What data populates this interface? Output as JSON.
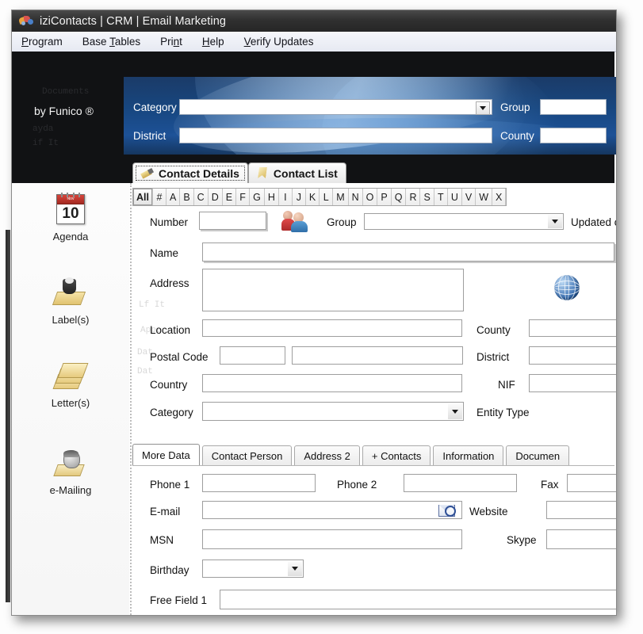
{
  "window": {
    "title": "iziContacts | CRM | Email Marketing",
    "title_icon": "butterfly-logo-icon",
    "brand": "by Funico ®"
  },
  "menu": {
    "items": [
      {
        "label": "Program",
        "accel": "P"
      },
      {
        "label": "Base Tables",
        "accel": "T"
      },
      {
        "label": "Print",
        "accel": "n"
      },
      {
        "label": "Help",
        "accel": "H"
      },
      {
        "label": "Verify Updates",
        "accel": "V"
      }
    ]
  },
  "banner": {
    "category_label": "Category",
    "category_value": "",
    "district_label": "District",
    "district_value": "",
    "group_label": "Group",
    "group_value": "",
    "county_label": "County",
    "county_value": ""
  },
  "main_tabs": [
    {
      "label": "Contact Details",
      "icon": "pencil-icon",
      "active": true
    },
    {
      "label": "Contact List",
      "icon": "bookmark-icon",
      "active": false
    }
  ],
  "alpha_filter": {
    "selected": "All",
    "items": [
      "All",
      "#",
      "A",
      "B",
      "C",
      "D",
      "E",
      "F",
      "G",
      "H",
      "I",
      "J",
      "K",
      "L",
      "M",
      "N",
      "O",
      "P",
      "Q",
      "R",
      "S",
      "T",
      "U",
      "V",
      "W",
      "X"
    ]
  },
  "sidebar": {
    "items": [
      {
        "label": "Agenda",
        "icon": "calendar-icon",
        "day": "10",
        "month": "Nov"
      },
      {
        "label": "Label(s)",
        "icon": "label-printer-icon"
      },
      {
        "label": "Letter(s)",
        "icon": "letters-icon"
      },
      {
        "label": "e-Mailing",
        "icon": "email-person-icon"
      }
    ]
  },
  "form": {
    "number_label": "Number",
    "number_value": "",
    "people_icon": "two-people-icon",
    "group_label": "Group",
    "group_value": "",
    "updated_label": "Updated o",
    "name_label": "Name",
    "name_value": "",
    "address_label": "Address",
    "address_value": "",
    "globe_icon": "globe-icon",
    "location_label": "Location",
    "location_value": "",
    "county_label": "County",
    "county_value": "",
    "postal_code_label": "Postal Code",
    "postal_code_value": "",
    "postal_city_value": "",
    "district_label": "District",
    "district_value": "",
    "country_label": "Country",
    "country_value": "",
    "nif_label": "NIF",
    "nif_value": "",
    "category_label": "Category",
    "category_value": "",
    "entity_type_label": "Entity Type"
  },
  "sub_tabs": [
    {
      "label": "More Data",
      "active": true
    },
    {
      "label": "Contact Person",
      "active": false
    },
    {
      "label": "Address 2",
      "active": false
    },
    {
      "label": "+ Contacts",
      "active": false
    },
    {
      "label": "Information",
      "active": false
    },
    {
      "label": "Documen",
      "active": false
    }
  ],
  "more_data": {
    "phone1_label": "Phone 1",
    "phone1_value": "",
    "phone2_label": "Phone 2",
    "phone2_value": "",
    "fax_label": "Fax",
    "fax_value": "",
    "email_label": "E-mail",
    "email_value": "",
    "email_icon": "email-search-icon",
    "website_label": "Website",
    "website_value": "",
    "msn_label": "MSN",
    "msn_value": "",
    "skype_label": "Skype",
    "skype_value": "",
    "birthday_label": "Birthday",
    "birthday_value": "",
    "free_field1_label": "Free Field 1",
    "free_field1_value": ""
  },
  "colors": {
    "banner_blue": "#1d5196",
    "banner_dark": "#15365f",
    "titlebar": "#303030",
    "app_background": "#111214",
    "accent_red": "#d8453c"
  }
}
